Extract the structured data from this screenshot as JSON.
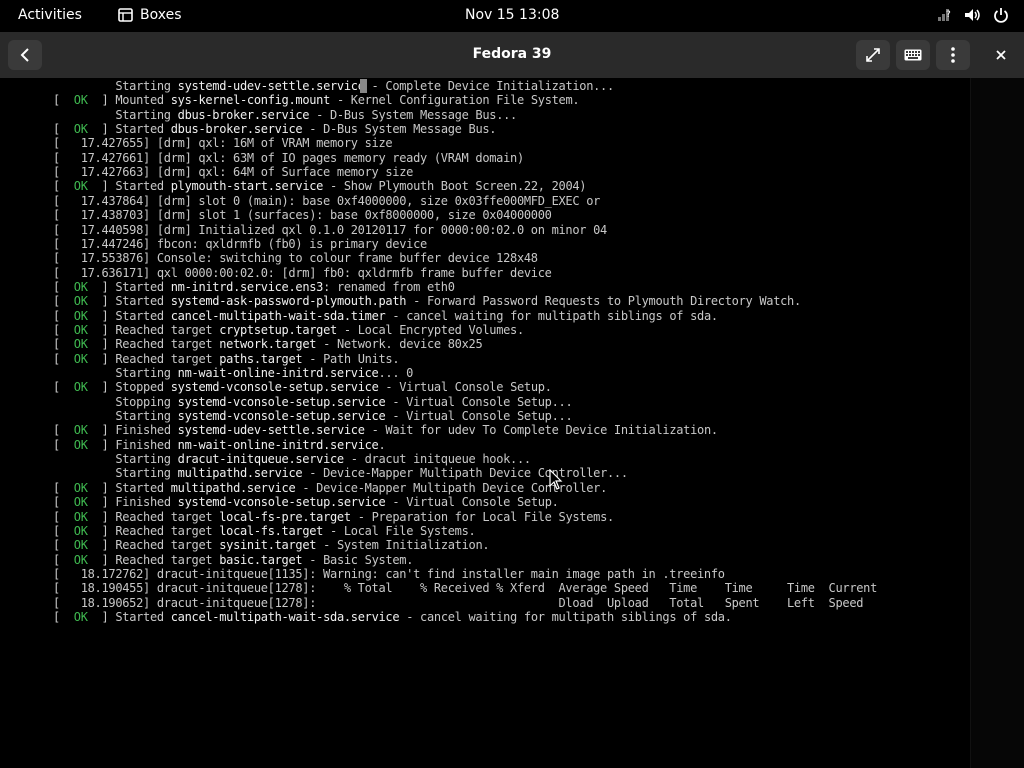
{
  "topbar": {
    "activities": "Activities",
    "app_name": "Boxes",
    "clock": "Nov 15  13:08"
  },
  "header": {
    "title": "Fedora 39"
  },
  "console": {
    "lines": [
      {
        "pre": "         Starting ",
        "unit": "systemd-udev-settle.service",
        "post": " - Complete Device Initialization..."
      },
      {
        "status": "OK",
        "pre": "] Mounted ",
        "unit": "sys-kernel-config.mount",
        "post": " - Kernel Configuration File System."
      },
      {
        "pre": "         Starting ",
        "unit": "dbus-broker.service",
        "post": " - D-Bus System Message Bus..."
      },
      {
        "status": "OK",
        "pre": "] Started ",
        "unit": "dbus-broker.service",
        "post": " - D-Bus System Message Bus."
      },
      {
        "pre": "[   17.427655] [drm] qxl: 16M of VRAM memory size"
      },
      {
        "pre": "[   17.427661] [drm] qxl: 63M of IO pages memory ready (VRAM domain)"
      },
      {
        "pre": "[   17.427663] [drm] qxl: 64M of Surface memory size"
      },
      {
        "status": "OK",
        "pre": "] Started ",
        "unit": "plymouth-start.service",
        "post": " - Show Plymouth Boot Screen.22, 2004)"
      },
      {
        "pre": "[   17.437864] [drm] slot 0 (main): base 0xf4000000, size 0x03ffe000MFD_EXEC or"
      },
      {
        "pre": "[   17.438703] [drm] slot 1 (surfaces): base 0xf8000000, size 0x04000000"
      },
      {
        "pre": "[   17.440598] [drm] Initialized qxl 0.1.0 20120117 for 0000:00:02.0 on minor 04"
      },
      {
        "pre": "[   17.447246] fbcon: qxldrmfb (fb0) is primary device"
      },
      {
        "pre": "[   17.553876] Console: switching to colour frame buffer device 128x48"
      },
      {
        "pre": "[   17.636171] qxl 0000:00:02.0: [drm] fb0: qxldrmfb frame buffer device"
      },
      {
        "status": "OK",
        "pre": "] Started ",
        "unit": "nm-initrd.service.ens3",
        "post": ": renamed from eth0"
      },
      {
        "status": "OK",
        "pre": "] Started ",
        "unit": "systemd-ask-password-plymouth.path",
        "post": " - Forward Password Requests to Plymouth Directory Watch."
      },
      {
        "status": "OK",
        "pre": "] Started ",
        "unit": "cancel-multipath-wait-sda.timer",
        "post": " - cancel waiting for multipath siblings of sda."
      },
      {
        "status": "OK",
        "pre": "] Reached target ",
        "unit": "cryptsetup.target",
        "post": " - Local Encrypted Volumes."
      },
      {
        "status": "OK",
        "pre": "] Reached target ",
        "unit": "network.target",
        "post": " - Network. device 80x25"
      },
      {
        "status": "OK",
        "pre": "] Reached target ",
        "unit": "paths.target",
        "post": " - Path Units."
      },
      {
        "pre": "         Starting ",
        "unit": "nm-wait-online-initrd.service",
        "post": "... 0"
      },
      {
        "status": "OK",
        "pre": "] Stopped ",
        "unit": "systemd-vconsole-setup.service",
        "post": " - Virtual Console Setup."
      },
      {
        "pre": "         Stopping ",
        "unit": "systemd-vconsole-setup.service",
        "post": " - Virtual Console Setup..."
      },
      {
        "pre": "         Starting ",
        "unit": "systemd-vconsole-setup.service",
        "post": " - Virtual Console Setup..."
      },
      {
        "status": "OK",
        "pre": "] Finished ",
        "unit": "systemd-udev-settle.service",
        "post": " - Wait for udev To Complete Device Initialization."
      },
      {
        "status": "OK",
        "pre": "] Finished ",
        "unit": "nm-wait-online-initrd.service",
        "post": "."
      },
      {
        "pre": "         Starting ",
        "unit": "dracut-initqueue.service",
        "post": " - dracut initqueue hook..."
      },
      {
        "pre": "         Starting ",
        "unit": "multipathd.service",
        "post": " - Device-Mapper Multipath Device Controller..."
      },
      {
        "status": "OK",
        "pre": "] Started ",
        "unit": "multipathd.service",
        "post": " - Device-Mapper Multipath Device Controller."
      },
      {
        "status": "OK",
        "pre": "] Finished ",
        "unit": "systemd-vconsole-setup.service",
        "post": " - Virtual Console Setup."
      },
      {
        "status": "OK",
        "pre": "] Reached target ",
        "unit": "local-fs-pre.target",
        "post": " - Preparation for Local File Systems."
      },
      {
        "status": "OK",
        "pre": "] Reached target ",
        "unit": "local-fs.target",
        "post": " - Local File Systems."
      },
      {
        "status": "OK",
        "pre": "] Reached target ",
        "unit": "sysinit.target",
        "post": " - System Initialization."
      },
      {
        "status": "OK",
        "pre": "] Reached target ",
        "unit": "basic.target",
        "post": " - Basic System."
      },
      {
        "pre": "[   18.172762] dracut-initqueue[1135]: Warning: can't find installer main image path in .treeinfo"
      },
      {
        "pre": "[   18.190455] dracut-initqueue[1278]:    % Total    % Received % Xferd  Average Speed   Time    Time     Time  Current"
      },
      {
        "pre": "[   18.190652] dracut-initqueue[1278]:                                   Dload  Upload   Total   Spent    Left  Speed"
      },
      {
        "status": "OK",
        "pre": "] Started ",
        "unit": "cancel-multipath-wait-sda.service",
        "post": " - cancel waiting for multipath siblings of sda."
      }
    ]
  }
}
